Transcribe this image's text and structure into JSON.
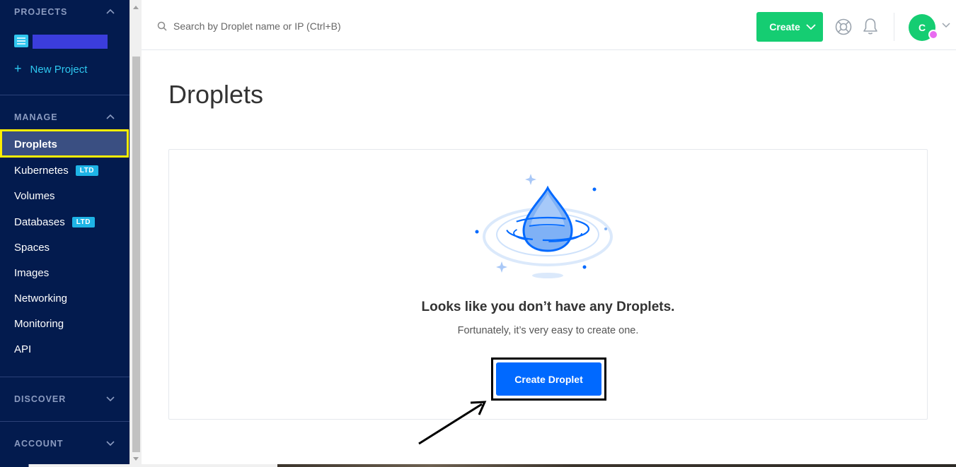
{
  "sidebar": {
    "projects_heading": "PROJECTS",
    "new_project_label": "New Project",
    "manage_heading": "MANAGE",
    "items": [
      {
        "label": "Droplets"
      },
      {
        "label": "Kubernetes",
        "badge": "LTD"
      },
      {
        "label": "Volumes"
      },
      {
        "label": "Databases",
        "badge": "LTD"
      },
      {
        "label": "Spaces"
      },
      {
        "label": "Images"
      },
      {
        "label": "Networking"
      },
      {
        "label": "Monitoring"
      },
      {
        "label": "API"
      }
    ],
    "discover_heading": "DISCOVER",
    "account_heading": "ACCOUNT"
  },
  "header": {
    "search_placeholder": "Search by Droplet name or IP (Ctrl+B)",
    "create_label": "Create",
    "avatar_initial": "C"
  },
  "main": {
    "title": "Droplets",
    "empty_heading": "Looks like you don’t have any Droplets.",
    "empty_subtext": "Fortunately, it’s very easy to create one.",
    "create_droplet_label": "Create Droplet"
  },
  "colors": {
    "sidebar_bg": "#031b4e",
    "create_green": "#15cd72",
    "primary_blue": "#0069ff",
    "badge_blue": "#1eb4e6",
    "highlight_yellow": "#ffee00"
  }
}
